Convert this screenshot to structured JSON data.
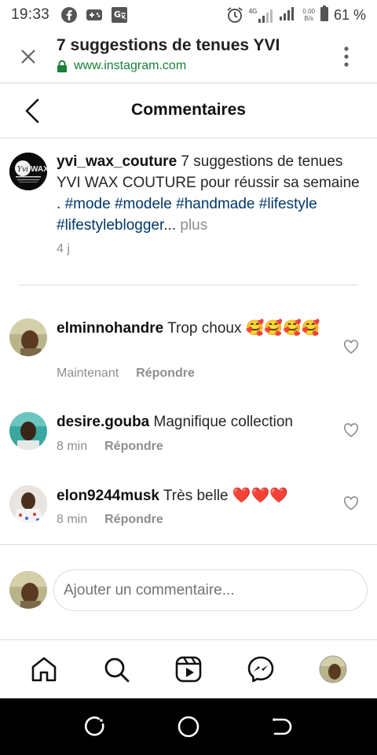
{
  "status_bar": {
    "time": "19:33",
    "network": "4G",
    "speed_value": "0.00",
    "speed_unit": "B/s",
    "battery": "61 %"
  },
  "browser": {
    "page_title": "7 suggestions de tenues YVI",
    "url": "www.instagram.com"
  },
  "header": {
    "title": "Commentaires"
  },
  "caption": {
    "username": "yvi_wax_couture",
    "text_intro": " 7 suggestions de tenues YVI WAX COUTURE pour réussir sa semaine . ",
    "hashtags": [
      "#mode",
      "#modele",
      "#handmade",
      "#lifestyle",
      "#lifestyleblogger"
    ],
    "ellipsis": "...",
    "more_label": " plus",
    "time": "4 j",
    "avatar_text": "Yvi WAX"
  },
  "comments": [
    {
      "username": "elminnohandre",
      "text": " Trop choux ",
      "emoji": "🥰🥰🥰🥰",
      "time": "Maintenant",
      "reply_label": "Répondre"
    },
    {
      "username": "desire.gouba",
      "text": " Magnifique collection",
      "emoji": "",
      "time": "8 min",
      "reply_label": "Répondre"
    },
    {
      "username": "elon9244musk",
      "text": " Très belle ",
      "emoji": "❤️❤️❤️",
      "time": "8 min",
      "reply_label": "Répondre"
    }
  ],
  "add_comment": {
    "placeholder": "Ajouter un commentaire..."
  },
  "colors": {
    "hashtag": "#00376b",
    "muted": "#8e8e8e",
    "url_green": "#188038",
    "heart_red": "#e0245e"
  }
}
